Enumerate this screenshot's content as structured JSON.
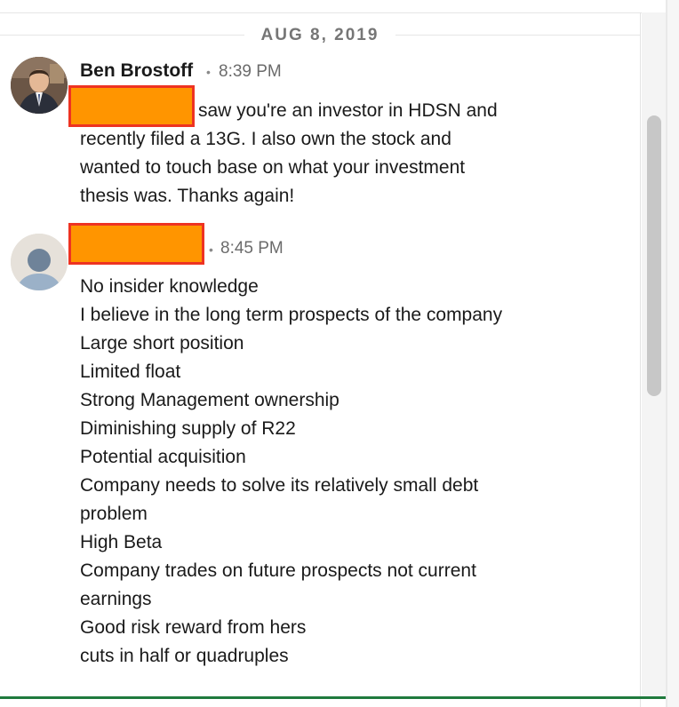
{
  "conversation": {
    "date_divider": "AUG 8, 2019",
    "messages": [
      {
        "sender": "Ben Brostoff",
        "separator": "•",
        "time": "8:39 PM",
        "lines": [
          "saw you're an investor in HDSN and",
          "recently filed a 13G. I also own the stock and",
          "wanted to touch base on what your investment",
          "thesis was. Thanks again!"
        ]
      },
      {
        "sender": "",
        "separator": "•",
        "time": "8:45 PM",
        "lines": [
          "No insider knowledge",
          "I believe in the long term prospects of the company",
          "Large short position",
          "Limited float",
          "Strong Management ownership",
          "Diminishing supply of R22",
          "Potential acquisition",
          "Company needs to solve its relatively small debt",
          "problem",
          "High Beta",
          "Company trades on future prospects not current",
          "earnings",
          "Good risk reward from hers",
          "cuts in half or quadruples"
        ]
      }
    ]
  },
  "colors": {
    "redaction_fill": "#ff9500",
    "redaction_border": "#ee3322",
    "accent_bottom_bar": "#1f7a3d"
  }
}
